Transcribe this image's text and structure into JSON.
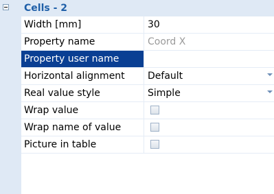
{
  "category": {
    "label": "Cells - 2",
    "expanded": true
  },
  "properties": [
    {
      "name": "Width [mm]",
      "value": "30",
      "type": "text"
    },
    {
      "name": "Property name",
      "value": "Coord X",
      "type": "text",
      "muted": true
    },
    {
      "name": "Property user name",
      "value": "",
      "type": "text",
      "selected": true
    },
    {
      "name": "Horizontal alignment",
      "value": "Default",
      "type": "dropdown"
    },
    {
      "name": "Real value style",
      "value": "Simple",
      "type": "dropdown"
    },
    {
      "name": "Wrap value",
      "checked": false,
      "type": "checkbox"
    },
    {
      "name": "Wrap name of value",
      "checked": false,
      "type": "checkbox"
    },
    {
      "name": "Picture in table",
      "checked": false,
      "type": "checkbox"
    }
  ],
  "colors": {
    "category_background": "#dfe9f5",
    "category_text": "#1f5fa8",
    "selection": "#0a3f93"
  }
}
